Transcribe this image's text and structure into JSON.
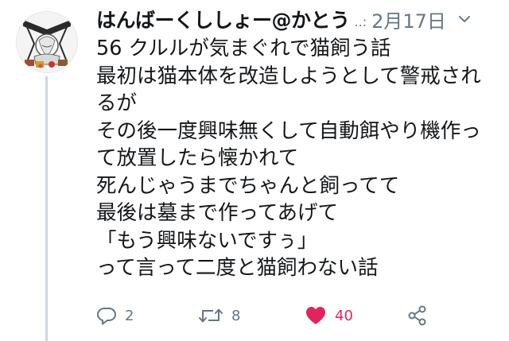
{
  "tweet": {
    "author_name": "はんばーくししょー@かとう",
    "more_indicator": "..:",
    "date": "2月17日",
    "body_lines": [
      "56 クルルが気まぐれで猫飼う話",
      "最初は猫本体を改造しようとして警戒され",
      "るが",
      "その後一度興味無くして自動餌やり機作っ",
      "て放置したら懐かれて",
      "死んじゃうまでちゃんと飼ってて",
      "最後は墓まで作ってあげて",
      "「もう興味ないですぅ」",
      "って言って二度と猫飼わない話"
    ]
  },
  "actions": {
    "reply_count": "2",
    "retweet_count": "8",
    "like_count": "40"
  },
  "colors": {
    "text": "#14171a",
    "secondary": "#657786",
    "like": "#e0245e",
    "thread_line": "#ccd6dd"
  },
  "icons": [
    "reply-icon",
    "retweet-icon",
    "heart-icon",
    "share-icon",
    "chevron-down-icon"
  ]
}
